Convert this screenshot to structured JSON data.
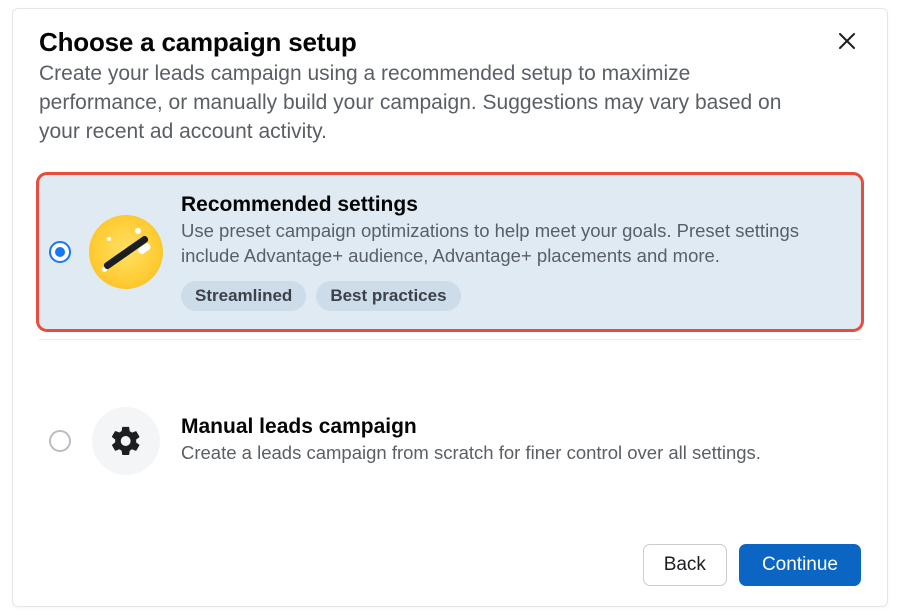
{
  "header": {
    "title": "Choose a campaign setup",
    "subtitle": "Create your leads campaign using a recommended setup to maximize performance, or manually build your campaign. Suggestions may vary based on your recent ad account activity."
  },
  "options": {
    "recommended": {
      "title": "Recommended settings",
      "desc": "Use preset campaign optimizations to help meet your goals. Preset settings include Advantage+ audience, Advantage+ placements and more.",
      "tags": [
        "Streamlined",
        "Best practices"
      ],
      "selected": true
    },
    "manual": {
      "title": "Manual leads campaign",
      "desc": "Create a leads campaign from scratch for finer control over all settings.",
      "selected": false
    }
  },
  "footer": {
    "back": "Back",
    "continue": "Continue"
  }
}
